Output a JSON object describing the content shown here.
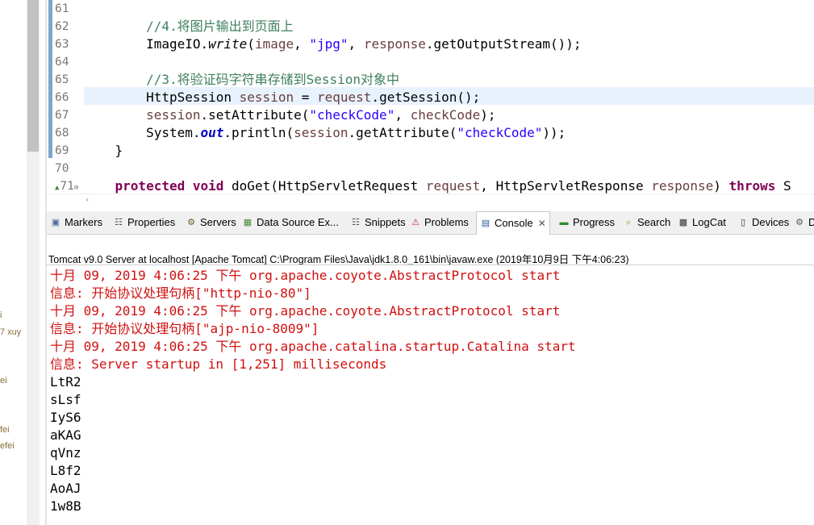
{
  "sidebar_fragments": [
    "i",
    "7  xuy",
    "ei",
    "fei",
    "efei"
  ],
  "editor": {
    "lines": [
      {
        "num": "61",
        "segments": []
      },
      {
        "num": "62",
        "segments": [
          {
            "t": "        "
          },
          {
            "t": "//4.将图片输出到页面上",
            "c": "cm"
          }
        ]
      },
      {
        "num": "63",
        "segments": [
          {
            "t": "        ImageIO."
          },
          {
            "t": "write",
            "c": "it"
          },
          {
            "t": "("
          },
          {
            "t": "image",
            "c": "var"
          },
          {
            "t": ", "
          },
          {
            "t": "\"jpg\"",
            "c": "str"
          },
          {
            "t": ", "
          },
          {
            "t": "response",
            "c": "var"
          },
          {
            "t": ".getOutputStream());"
          }
        ]
      },
      {
        "num": "64",
        "segments": []
      },
      {
        "num": "65",
        "segments": [
          {
            "t": "        "
          },
          {
            "t": "//3.将验证码字符串存储到Session对象中",
            "c": "cm"
          }
        ]
      },
      {
        "num": "66",
        "segments": [
          {
            "t": "        HttpSession "
          },
          {
            "t": "session",
            "c": "var"
          },
          {
            "t": " = "
          },
          {
            "t": "request",
            "c": "var"
          },
          {
            "t": ".getSession();"
          }
        ]
      },
      {
        "num": "67",
        "segments": [
          {
            "t": "        "
          },
          {
            "t": "session",
            "c": "var"
          },
          {
            "t": ".setAttribute("
          },
          {
            "t": "\"checkCode\"",
            "c": "str"
          },
          {
            "t": ", "
          },
          {
            "t": "checkCode",
            "c": "var"
          },
          {
            "t": ");"
          }
        ]
      },
      {
        "num": "68",
        "segments": [
          {
            "t": "        System."
          },
          {
            "t": "out",
            "c": "fld"
          },
          {
            "t": ".println("
          },
          {
            "t": "session",
            "c": "var"
          },
          {
            "t": ".getAttribute("
          },
          {
            "t": "\"checkCode\"",
            "c": "str"
          },
          {
            "t": "));"
          }
        ]
      },
      {
        "num": "69",
        "segments": [
          {
            "t": "    }"
          }
        ]
      },
      {
        "num": "70",
        "segments": []
      },
      {
        "num": "71",
        "segments": [
          {
            "t": "    "
          },
          {
            "t": "protected",
            "c": "kw"
          },
          {
            "t": " "
          },
          {
            "t": "void",
            "c": "kw"
          },
          {
            "t": " doGet(HttpServletRequest "
          },
          {
            "t": "request",
            "c": "var"
          },
          {
            "t": ", HttpServletResponse "
          },
          {
            "t": "response",
            "c": "var"
          },
          {
            "t": ") "
          },
          {
            "t": "throws",
            "c": "kw"
          },
          {
            "t": " S"
          }
        ]
      }
    ]
  },
  "tabs": [
    {
      "label": "Markers",
      "icon": "markers-icon"
    },
    {
      "label": "Properties",
      "icon": "properties-icon"
    },
    {
      "label": "Servers",
      "icon": "servers-icon"
    },
    {
      "label": "Data Source Ex...",
      "icon": "data-source-icon"
    },
    {
      "label": "Snippets",
      "icon": "snippets-icon"
    },
    {
      "label": "Problems",
      "icon": "problems-icon"
    },
    {
      "label": "Console",
      "icon": "console-icon",
      "active": true
    },
    {
      "label": "Progress",
      "icon": "progress-icon"
    },
    {
      "label": "Search",
      "icon": "search-icon"
    },
    {
      "label": "LogCat",
      "icon": "logcat-icon"
    },
    {
      "label": "Devices",
      "icon": "devices-icon"
    },
    {
      "label": "D",
      "icon": "gear-icon"
    }
  ],
  "console": {
    "title": "Tomcat v9.0 Server at localhost [Apache Tomcat] C:\\Program Files\\Java\\jdk1.8.0_161\\bin\\javaw.exe (2019年10月9日 下午4:06:23)",
    "lines": [
      {
        "text": "十月 09, 2019 4:06:25 下午 org.apache.coyote.AbstractProtocol start",
        "color": "#d01010"
      },
      {
        "text": "信息: 开始协议处理句柄[\"http-nio-80\"]",
        "color": "#d01010"
      },
      {
        "text": "十月 09, 2019 4:06:25 下午 org.apache.coyote.AbstractProtocol start",
        "color": "#d01010"
      },
      {
        "text": "信息: 开始协议处理句柄[\"ajp-nio-8009\"]",
        "color": "#d01010"
      },
      {
        "text": "十月 09, 2019 4:06:25 下午 org.apache.catalina.startup.Catalina start",
        "color": "#d01010"
      },
      {
        "text": "信息: Server startup in [1,251] milliseconds",
        "color": "#d01010"
      },
      {
        "text": "LtR2",
        "color": "#000000"
      },
      {
        "text": "sLsf",
        "color": "#000000"
      },
      {
        "text": "IyS6",
        "color": "#000000"
      },
      {
        "text": "aKAG",
        "color": "#000000"
      },
      {
        "text": "qVnz",
        "color": "#000000"
      },
      {
        "text": "L8f2",
        "color": "#000000"
      },
      {
        "text": "AoAJ",
        "color": "#000000"
      },
      {
        "text": "1w8B",
        "color": "#000000"
      }
    ]
  }
}
